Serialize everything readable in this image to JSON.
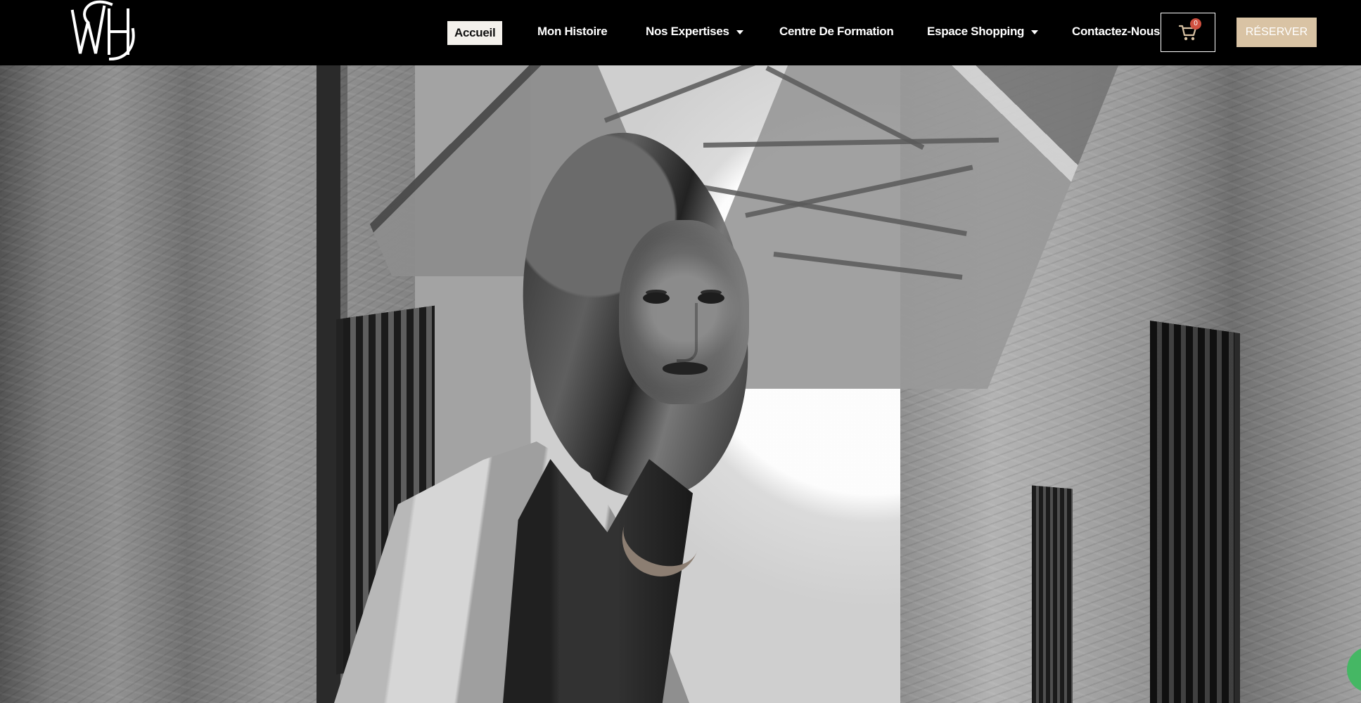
{
  "site": {
    "logo_alt": "WH"
  },
  "navigation": {
    "items": [
      {
        "label": "Accueil",
        "active": true
      },
      {
        "label": "Mon Histoire",
        "active": false
      },
      {
        "label": "Nos Expertises",
        "active": false,
        "has_dropdown": true
      },
      {
        "label": "Centre De Formation",
        "active": false
      },
      {
        "label": "Espace Shopping",
        "active": false,
        "has_dropdown": true
      },
      {
        "label": "Contactez-Nous",
        "active": false
      }
    ],
    "cart_count": "0",
    "reserve_label": "RÉSERVER"
  },
  "hero": {
    "image_label": "hero-fashion-photo"
  },
  "colors": {
    "header": "#000000",
    "active_nav": "#f4f1ec",
    "reserve": "#d9c3a4",
    "cart_badge": "#cf4f3f",
    "chat_tab": "#45b764"
  },
  "icons": {
    "logo": "monogram-logo",
    "cart": "shopping-cart-icon",
    "dropdown": "chevron-down-icon"
  }
}
